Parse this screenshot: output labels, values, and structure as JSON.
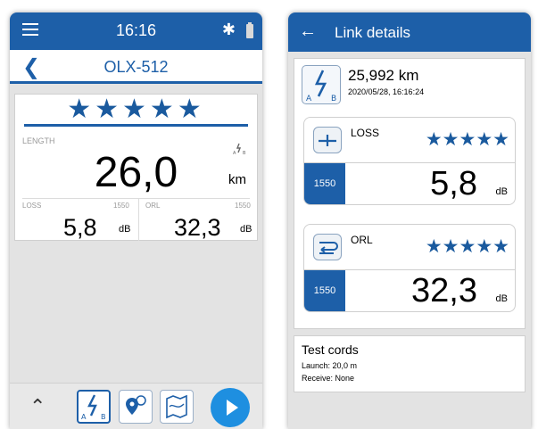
{
  "left": {
    "status_bar": {
      "time": "16:16",
      "bluetooth_icon": "bluetooth-icon",
      "battery_icon": "battery-icon"
    },
    "header": {
      "title": "OLX-512"
    },
    "summary": {
      "overall_stars": "★★★★★",
      "overall_rating": 5,
      "length_label": "LENGTH",
      "length_value": "26,0",
      "length_unit": "km",
      "loss": {
        "label": "LOSS",
        "wavelength": "1550",
        "value": "5,8",
        "unit": "dB"
      },
      "orl": {
        "label": "ORL",
        "wavelength": "1550",
        "value": "32,3",
        "unit": "dB"
      }
    },
    "toolbar": {
      "chevron": "^",
      "buttons": [
        "link-view-icon",
        "location-icon",
        "map-icon"
      ],
      "start_icon": "play-icon"
    }
  },
  "right": {
    "header": {
      "title": "Link details",
      "back_icon": "arrow-left-icon"
    },
    "link": {
      "distance": "25,992 km",
      "datetime": "2020/05/28, 16:16:24",
      "icon": "link-ab-icon"
    },
    "loss": {
      "label": "LOSS",
      "stars": "★★★★★",
      "rating": 5,
      "wavelength": "1550",
      "value": "5,8",
      "unit": "dB"
    },
    "orl": {
      "label": "ORL",
      "stars": "★★★★★",
      "rating": 5,
      "wavelength": "1550",
      "value": "32,3",
      "unit": "dB"
    },
    "test_cords": {
      "title": "Test cords",
      "launch": "Launch: 20,0 m",
      "receive": "Receive: None"
    }
  },
  "colors": {
    "primary": "#1d5fa8",
    "star": "#1a5a9e",
    "play": "#1e8fe0"
  }
}
